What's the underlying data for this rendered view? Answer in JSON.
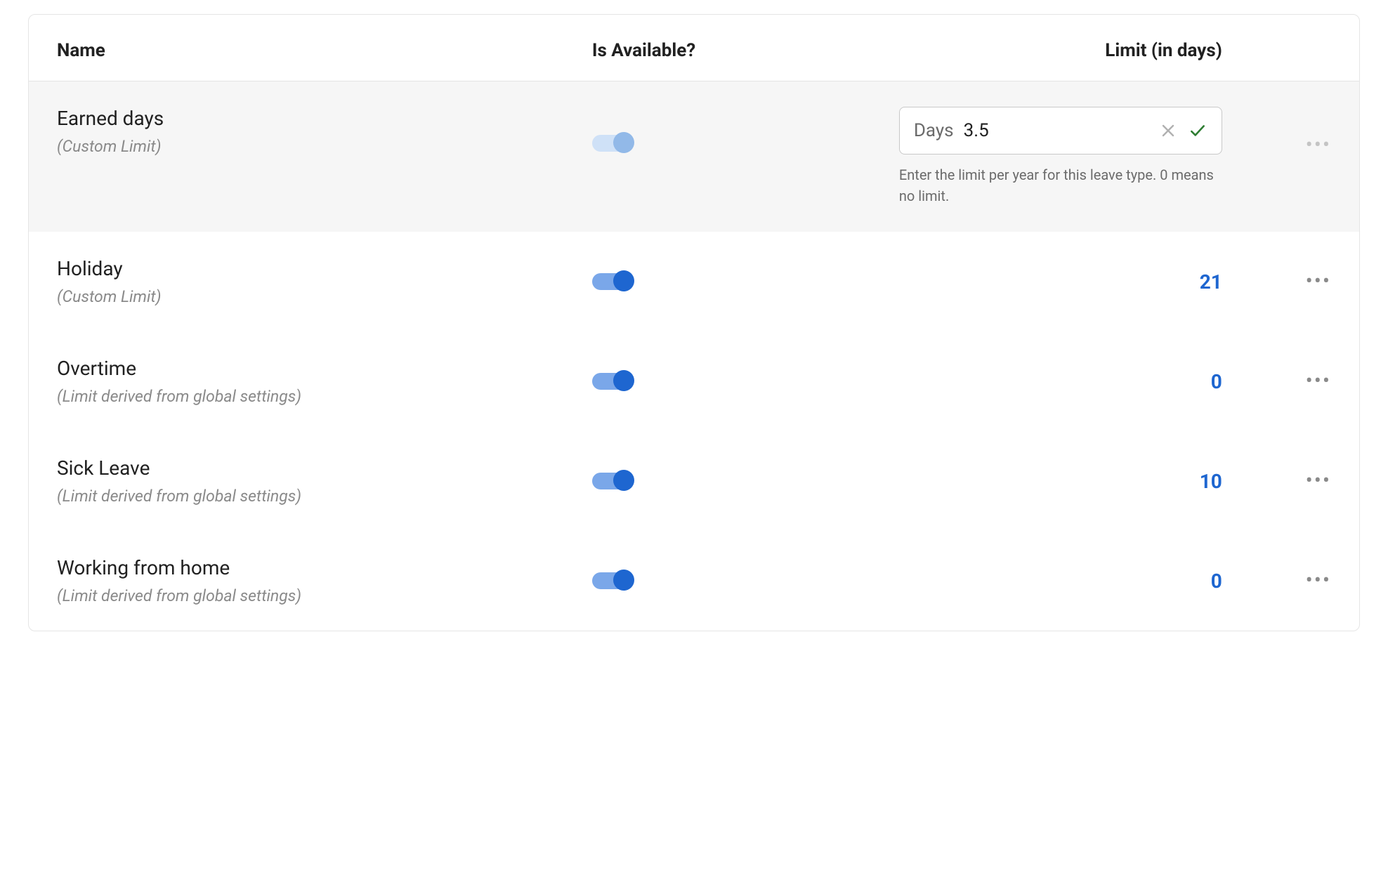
{
  "headers": {
    "name": "Name",
    "available": "Is Available?",
    "limit": "Limit (in days)"
  },
  "edit": {
    "field_label": "Days",
    "value": "3.5",
    "helper": "Enter the limit per year for this leave type. 0 means no limit."
  },
  "rows": [
    {
      "name": "Earned days",
      "sub": "(Custom Limit)",
      "available": false,
      "editing": true
    },
    {
      "name": "Holiday",
      "sub": "(Custom Limit)",
      "available": true,
      "limit": "21"
    },
    {
      "name": "Overtime",
      "sub": "(Limit derived from global settings)",
      "available": true,
      "limit": "0"
    },
    {
      "name": "Sick Leave",
      "sub": "(Limit derived from global settings)",
      "available": true,
      "limit": "10"
    },
    {
      "name": "Working from home",
      "sub": "(Limit derived from global settings)",
      "available": true,
      "limit": "0"
    }
  ]
}
